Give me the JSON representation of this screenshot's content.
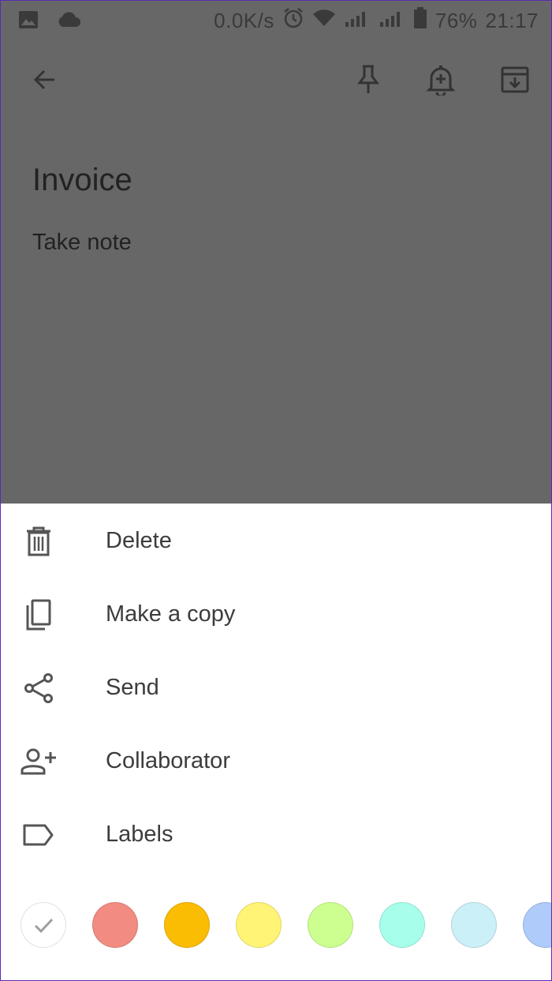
{
  "status_bar": {
    "speed": "0.0K/s",
    "battery": "76%",
    "time": "21:17",
    "icons": [
      "image-icon",
      "cloud-icon",
      "alarm-icon",
      "wifi-icon",
      "signal-icon",
      "signal-icon",
      "battery-icon"
    ]
  },
  "toolbar": {
    "icons": [
      "back-arrow-icon",
      "pin-icon",
      "reminder-bell-icon",
      "archive-icon"
    ]
  },
  "note": {
    "title": "Invoice",
    "body": "Take note"
  },
  "menu": {
    "items": [
      {
        "label": "Delete",
        "icon": "trash-icon"
      },
      {
        "label": "Make a copy",
        "icon": "copy-icon"
      },
      {
        "label": "Send",
        "icon": "share-icon"
      },
      {
        "label": "Collaborator",
        "icon": "add-person-icon"
      },
      {
        "label": "Labels",
        "icon": "label-icon"
      }
    ]
  },
  "colors": {
    "swatches": [
      {
        "name": "default",
        "hex": "#ffffff",
        "selected": true
      },
      {
        "name": "red",
        "hex": "#f28b82"
      },
      {
        "name": "orange",
        "hex": "#fbbc04"
      },
      {
        "name": "yellow",
        "hex": "#fff475"
      },
      {
        "name": "green",
        "hex": "#ccff90"
      },
      {
        "name": "teal",
        "hex": "#a7ffeb"
      },
      {
        "name": "blue",
        "hex": "#cbf0f8"
      },
      {
        "name": "dark-blue",
        "hex": "#aecbfa"
      }
    ]
  },
  "theme": {
    "scrim": "#676767",
    "icon": "#3a3a3a",
    "text": "#3c3c3c"
  }
}
